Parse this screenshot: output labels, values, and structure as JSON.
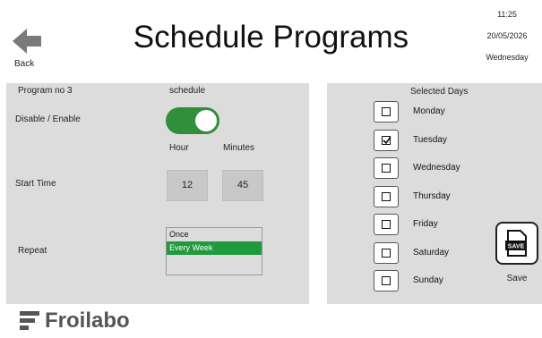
{
  "header": {
    "title": "Schedule Programs",
    "back_label": "Back",
    "clock": {
      "time": "11:25",
      "date": "20/05/2026",
      "weekday": "Wednesday"
    }
  },
  "left_panel": {
    "program_label": "Program no 3",
    "schedule_label": "schedule",
    "disable_enable_label": "Disable / Enable",
    "enabled": true,
    "hour_label": "Hour",
    "minutes_label": "Minutes",
    "start_time_label": "Start Time",
    "hour_value": "12",
    "minutes_value": "45",
    "repeat_label": "Repeat",
    "repeat_options": [
      "Once",
      "Every Week"
    ],
    "repeat_selected": "Every Week"
  },
  "right_panel": {
    "selected_days_label": "Selected Days",
    "days": [
      {
        "label": "Monday",
        "checked": false
      },
      {
        "label": "Tuesday",
        "checked": true
      },
      {
        "label": "Wednesday",
        "checked": false
      },
      {
        "label": "Thursday",
        "checked": false
      },
      {
        "label": "Friday",
        "checked": false
      },
      {
        "label": "Saturday",
        "checked": false
      },
      {
        "label": "Sunday",
        "checked": false
      }
    ],
    "save_icon_text": "SAVE",
    "save_label": "Save"
  },
  "footer": {
    "logo_text": "Froilabo"
  },
  "colors": {
    "toggle_on": "#2f8f3a",
    "repeat_selected": "#1f9a3d",
    "panel_bg": "#dcdcdc"
  }
}
